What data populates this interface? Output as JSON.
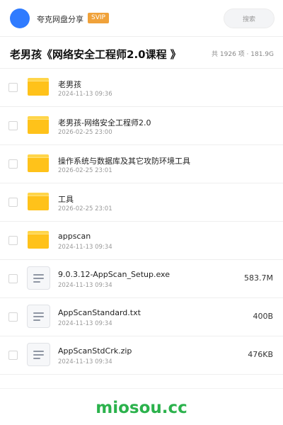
{
  "header": {
    "brand": "夸克网盘分享",
    "vip_badge": "SVIP",
    "search_placeholder": "搜索",
    "avatar_color": "#2f7bff"
  },
  "folder": {
    "title": "老男孩《网络安全工程师2.0课程 》",
    "summary": "共 1926 项 · 181.9G"
  },
  "files": [
    {
      "type": "folder",
      "icon": "folder-icon",
      "name": "老男孩",
      "date": "2024-11-13 09:36",
      "size": ""
    },
    {
      "type": "folder",
      "icon": "folder-icon",
      "name": "老男孩-网络安全工程师2.0",
      "date": "2026-02-25 23:00",
      "size": ""
    },
    {
      "type": "folder",
      "icon": "folder-icon",
      "name": "操作系统与数据库及其它攻防环境工具",
      "date": "2026-02-25 23:01",
      "size": ""
    },
    {
      "type": "folder",
      "icon": "folder-icon",
      "name": "工具",
      "date": "2026-02-25 23:01",
      "size": ""
    },
    {
      "type": "folder",
      "icon": "folder-icon",
      "name": "appscan",
      "date": "2024-11-13 09:34",
      "size": ""
    },
    {
      "type": "file",
      "icon": "file-icon",
      "name": "9.0.3.12-AppScan_Setup.exe",
      "date": "2024-11-13 09:34",
      "size": "583.7M"
    },
    {
      "type": "file",
      "icon": "file-icon",
      "name": "AppScanStandard.txt",
      "date": "2024-11-13 09:34",
      "size": "400B"
    },
    {
      "type": "file",
      "icon": "file-icon",
      "name": "AppScanStdCrk.zip",
      "date": "2024-11-13 09:34",
      "size": "476KB"
    }
  ],
  "watermark": "miosou.cc",
  "colors": {
    "folder": "#ffc21a",
    "vip": "#f0a23a",
    "watermark": "#2bb24c"
  }
}
